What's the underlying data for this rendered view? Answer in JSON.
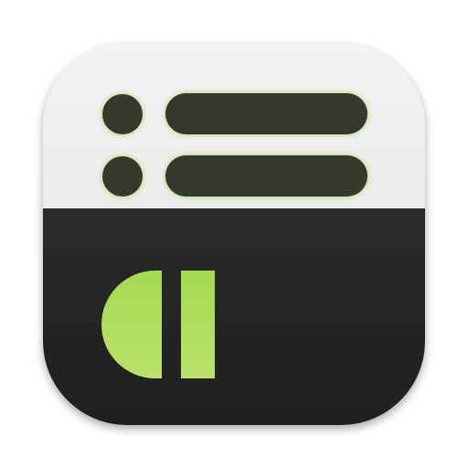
{
  "app_icon": {
    "icon_name": "list-playback-app-icon",
    "colors": {
      "top_panel": "#ececec",
      "top_panel_light": "#f3f3f3",
      "bottom_panel": "#2b2b2b",
      "bottom_panel_dark": "#1f1f1f",
      "list_item": "#34392c",
      "list_glow": "#9ad24a",
      "accent_green_top": "#a6da52",
      "accent_green_bottom": "#b9e26a"
    },
    "list_rows": [
      {
        "icon": "list-bullet-dot",
        "bar": "list-bar"
      },
      {
        "icon": "list-bullet-dot",
        "bar": "list-bar"
      }
    ],
    "bottom_glyph": "pause-d-glyph"
  }
}
